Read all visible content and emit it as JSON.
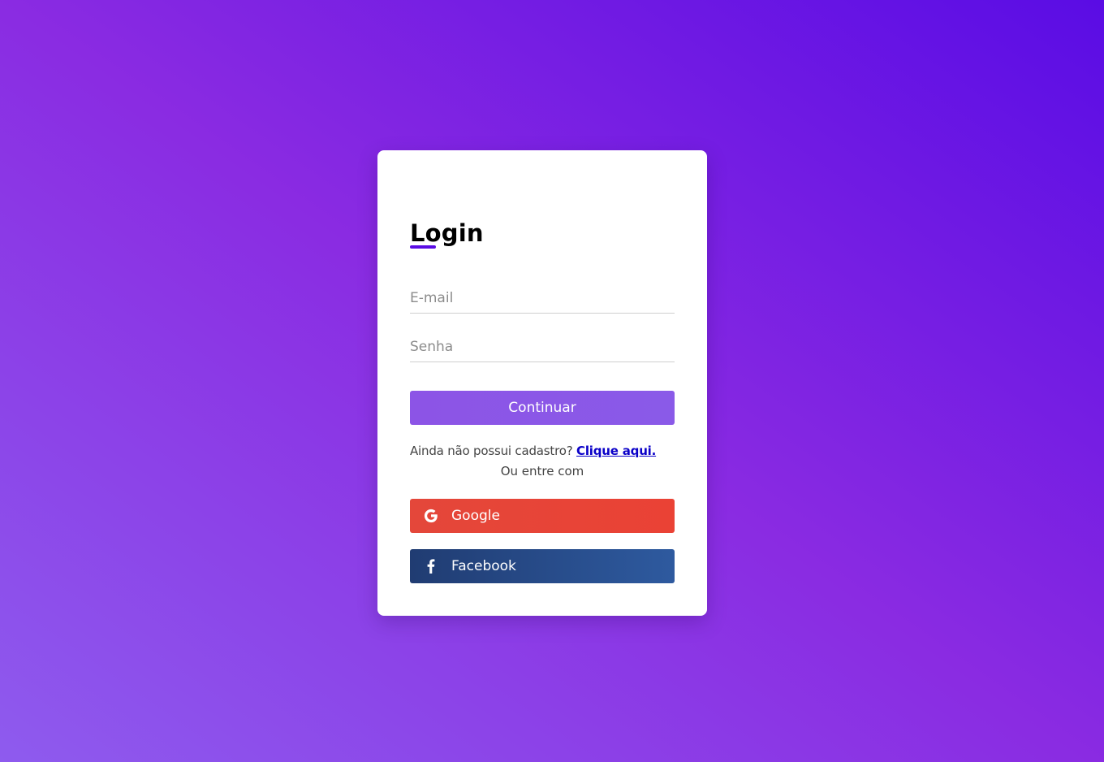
{
  "login": {
    "title": "Login",
    "email_placeholder": "E-mail",
    "password_placeholder": "Senha",
    "continue_label": "Continuar",
    "signup_prompt": "Ainda não possui cadastro? ",
    "signup_link": "Clique aqui.",
    "or_text": "Ou entre com",
    "google_label": "Google",
    "facebook_label": "Facebook"
  },
  "icons": {
    "google": "google-icon",
    "facebook": "facebook-icon"
  },
  "colors": {
    "accent": "#5a0ce4",
    "continue_button": "#8c54e6",
    "google_button": "#ea4335",
    "facebook_button": "#27477f",
    "link": "#0a00c8"
  }
}
